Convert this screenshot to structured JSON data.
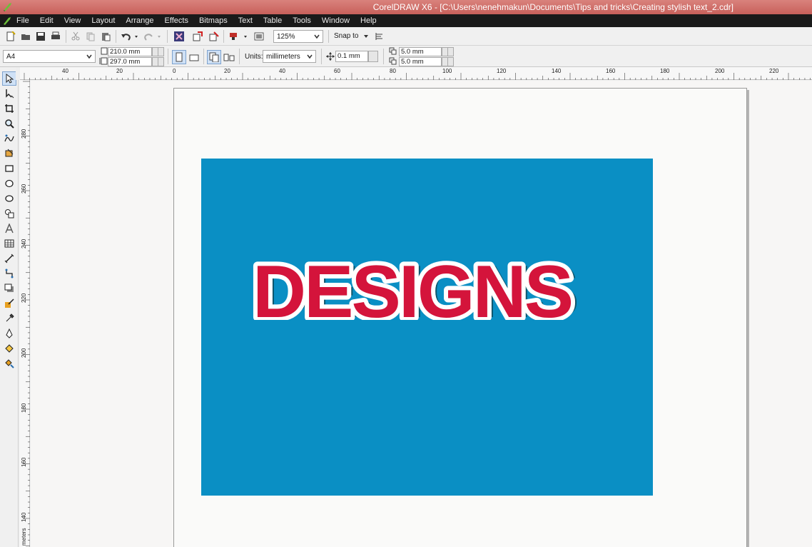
{
  "window": {
    "title": "CorelDRAW X6 - [C:\\Users\\nenehmakun\\Documents\\Tips and tricks\\Creating stylish text_2.cdr]"
  },
  "menu": [
    {
      "label": "File",
      "mnemonic": "F"
    },
    {
      "label": "Edit",
      "mnemonic": "E"
    },
    {
      "label": "View",
      "mnemonic": "V"
    },
    {
      "label": "Layout",
      "mnemonic": "L"
    },
    {
      "label": "Arrange",
      "mnemonic": "A"
    },
    {
      "label": "Effects",
      "mnemonic": "c"
    },
    {
      "label": "Bitmaps",
      "mnemonic": "B"
    },
    {
      "label": "Text",
      "mnemonic": "x"
    },
    {
      "label": "Table",
      "mnemonic": "T"
    },
    {
      "label": "Tools",
      "mnemonic": "o"
    },
    {
      "label": "Window",
      "mnemonic": "W"
    },
    {
      "label": "Help",
      "mnemonic": "H"
    }
  ],
  "standard_toolbar": {
    "zoom_value": "125%",
    "snap_to_label": "Snap to"
  },
  "property_bar": {
    "page_size": "A4",
    "width": "210.0 mm",
    "height": "297.0 mm",
    "units_label": "Units:",
    "units_value": "millimeters",
    "nudge": "0.1 mm",
    "dup_x": "5.0 mm",
    "dup_y": "5.0 mm"
  },
  "ruler": {
    "horizontal_labels": [
      "40",
      "20",
      "0",
      "20",
      "40",
      "60",
      "80",
      "100",
      "120",
      "140",
      "160",
      "180",
      "200",
      "220"
    ],
    "vertical_labels": [
      "280",
      "260",
      "240",
      "220",
      "200",
      "180",
      "160",
      "140"
    ],
    "vertical_unit": "meters"
  },
  "artwork": {
    "text": "DESIGNS",
    "background_color": "#0a8fc4",
    "text_color": "#d4143b",
    "outline_color": "#ffffff",
    "shadow_color": "#0d4a5c"
  },
  "icons": {
    "toolbox": [
      "pick-tool-icon",
      "shape-tool-icon",
      "crop-tool-icon",
      "zoom-tool-icon",
      "freehand-tool-icon",
      "smart-fill-icon",
      "rectangle-tool-icon",
      "ellipse-tool-icon",
      "polygon-tool-icon",
      "basic-shapes-icon",
      "text-tool-icon",
      "table-tool-icon",
      "dimension-tool-icon",
      "connector-tool-icon",
      "drop-shadow-tool-icon",
      "transparency-tool-icon",
      "eyedropper-tool-icon",
      "outline-pen-icon",
      "fill-tool-icon",
      "interactive-fill-icon"
    ]
  }
}
